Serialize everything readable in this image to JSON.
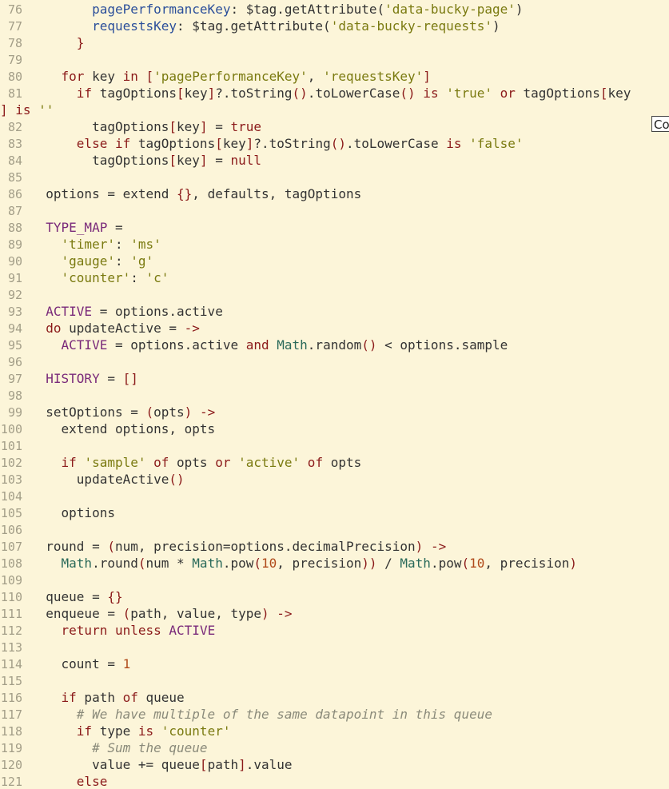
{
  "editor": {
    "lines": [
      {
        "num": "76",
        "indent": 4,
        "tokens": [
          {
            "t": "pagePerformanceKey",
            "c": "prop"
          },
          {
            "t": ": $tag.getAttribute(",
            "c": "default"
          },
          {
            "t": "'data-bucky-page'",
            "c": "str"
          },
          {
            "t": ")",
            "c": "default"
          }
        ]
      },
      {
        "num": "77",
        "indent": 4,
        "tokens": [
          {
            "t": "requestsKey",
            "c": "prop"
          },
          {
            "t": ": $tag.getAttribute(",
            "c": "default"
          },
          {
            "t": "'data-bucky-requests'",
            "c": "str"
          },
          {
            "t": ")",
            "c": "default"
          }
        ]
      },
      {
        "num": "78",
        "indent": 3,
        "tokens": [
          {
            "t": "}",
            "c": "punc"
          }
        ]
      },
      {
        "num": "79",
        "indent": 0,
        "tokens": []
      },
      {
        "num": "80",
        "indent": 2,
        "tokens": [
          {
            "t": "for",
            "c": "kw"
          },
          {
            "t": " key ",
            "c": "default"
          },
          {
            "t": "in",
            "c": "kw"
          },
          {
            "t": " [",
            "c": "punc"
          },
          {
            "t": "'pagePerformanceKey'",
            "c": "str"
          },
          {
            "t": ", ",
            "c": "default"
          },
          {
            "t": "'requestsKey'",
            "c": "str"
          },
          {
            "t": "]",
            "c": "punc"
          }
        ]
      },
      {
        "num": "81",
        "indent": 3,
        "tokens": [
          {
            "t": "if",
            "c": "kw"
          },
          {
            "t": " tagOptions",
            "c": "default"
          },
          {
            "t": "[",
            "c": "punc"
          },
          {
            "t": "key",
            "c": "default"
          },
          {
            "t": "]",
            "c": "punc"
          },
          {
            "t": "?.toString",
            "c": "default"
          },
          {
            "t": "()",
            "c": "punc"
          },
          {
            "t": ".toLowerCase",
            "c": "default"
          },
          {
            "t": "()",
            "c": "punc"
          },
          {
            "t": " is ",
            "c": "kw"
          },
          {
            "t": "'true'",
            "c": "str"
          },
          {
            "t": " or ",
            "c": "kw"
          },
          {
            "t": "tagOptions",
            "c": "default"
          },
          {
            "t": "[",
            "c": "punc"
          },
          {
            "t": "key",
            "c": "default"
          }
        ]
      },
      {
        "num": "",
        "indent": 0,
        "wrap": true,
        "tokens": [
          {
            "t": "]",
            "c": "punc"
          },
          {
            "t": " is ",
            "c": "kw"
          },
          {
            "t": "''",
            "c": "str"
          }
        ]
      },
      {
        "num": "82",
        "indent": 4,
        "tokens": [
          {
            "t": "tagOptions",
            "c": "default"
          },
          {
            "t": "[",
            "c": "punc"
          },
          {
            "t": "key",
            "c": "default"
          },
          {
            "t": "]",
            "c": "punc"
          },
          {
            "t": " = ",
            "c": "default"
          },
          {
            "t": "true",
            "c": "bool"
          }
        ]
      },
      {
        "num": "83",
        "indent": 3,
        "tokens": [
          {
            "t": "else if",
            "c": "kw"
          },
          {
            "t": " tagOptions",
            "c": "default"
          },
          {
            "t": "[",
            "c": "punc"
          },
          {
            "t": "key",
            "c": "default"
          },
          {
            "t": "]",
            "c": "punc"
          },
          {
            "t": "?.toString",
            "c": "default"
          },
          {
            "t": "()",
            "c": "punc"
          },
          {
            "t": ".toLowerCase",
            "c": "default"
          },
          {
            "t": " is ",
            "c": "kw"
          },
          {
            "t": "'false'",
            "c": "str"
          }
        ]
      },
      {
        "num": "84",
        "indent": 4,
        "tokens": [
          {
            "t": "tagOptions",
            "c": "default"
          },
          {
            "t": "[",
            "c": "punc"
          },
          {
            "t": "key",
            "c": "default"
          },
          {
            "t": "]",
            "c": "punc"
          },
          {
            "t": " = ",
            "c": "default"
          },
          {
            "t": "null",
            "c": "bool"
          }
        ]
      },
      {
        "num": "85",
        "indent": 0,
        "tokens": []
      },
      {
        "num": "86",
        "indent": 1,
        "tokens": [
          {
            "t": "options = extend ",
            "c": "default"
          },
          {
            "t": "{}",
            "c": "punc"
          },
          {
            "t": ", defaults, tagOptions",
            "c": "default"
          }
        ]
      },
      {
        "num": "87",
        "indent": 0,
        "tokens": []
      },
      {
        "num": "88",
        "indent": 1,
        "tokens": [
          {
            "t": "TYPE_MAP",
            "c": "const"
          },
          {
            "t": " =",
            "c": "default"
          }
        ]
      },
      {
        "num": "89",
        "indent": 2,
        "tokens": [
          {
            "t": "'timer'",
            "c": "str"
          },
          {
            "t": ": ",
            "c": "default"
          },
          {
            "t": "'ms'",
            "c": "str"
          }
        ]
      },
      {
        "num": "90",
        "indent": 2,
        "tokens": [
          {
            "t": "'gauge'",
            "c": "str"
          },
          {
            "t": ": ",
            "c": "default"
          },
          {
            "t": "'g'",
            "c": "str"
          }
        ]
      },
      {
        "num": "91",
        "indent": 2,
        "tokens": [
          {
            "t": "'counter'",
            "c": "str"
          },
          {
            "t": ": ",
            "c": "default"
          },
          {
            "t": "'c'",
            "c": "str"
          }
        ]
      },
      {
        "num": "92",
        "indent": 0,
        "tokens": []
      },
      {
        "num": "93",
        "indent": 1,
        "tokens": [
          {
            "t": "ACTIVE",
            "c": "const"
          },
          {
            "t": " = options.active",
            "c": "default"
          }
        ]
      },
      {
        "num": "94",
        "indent": 1,
        "tokens": [
          {
            "t": "do",
            "c": "kw"
          },
          {
            "t": " updateActive = ",
            "c": "default"
          },
          {
            "t": "->",
            "c": "kw"
          }
        ]
      },
      {
        "num": "95",
        "indent": 2,
        "tokens": [
          {
            "t": "ACTIVE",
            "c": "const"
          },
          {
            "t": " = options.active ",
            "c": "default"
          },
          {
            "t": "and",
            "c": "kw"
          },
          {
            "t": " ",
            "c": "default"
          },
          {
            "t": "Math",
            "c": "cls"
          },
          {
            "t": ".random",
            "c": "default"
          },
          {
            "t": "()",
            "c": "punc"
          },
          {
            "t": " < options.sample",
            "c": "default"
          }
        ]
      },
      {
        "num": "96",
        "indent": 0,
        "tokens": []
      },
      {
        "num": "97",
        "indent": 1,
        "tokens": [
          {
            "t": "HISTORY",
            "c": "const"
          },
          {
            "t": " = ",
            "c": "default"
          },
          {
            "t": "[]",
            "c": "punc"
          }
        ]
      },
      {
        "num": "98",
        "indent": 0,
        "tokens": []
      },
      {
        "num": "99",
        "indent": 1,
        "tokens": [
          {
            "t": "setOptions = ",
            "c": "default"
          },
          {
            "t": "(",
            "c": "punc"
          },
          {
            "t": "opts",
            "c": "default"
          },
          {
            "t": ")",
            "c": "punc"
          },
          {
            "t": " ",
            "c": "default"
          },
          {
            "t": "->",
            "c": "kw"
          }
        ]
      },
      {
        "num": "100",
        "indent": 2,
        "tokens": [
          {
            "t": "extend options, opts",
            "c": "default"
          }
        ]
      },
      {
        "num": "101",
        "indent": 0,
        "tokens": []
      },
      {
        "num": "102",
        "indent": 2,
        "tokens": [
          {
            "t": "if",
            "c": "kw"
          },
          {
            "t": " ",
            "c": "default"
          },
          {
            "t": "'sample'",
            "c": "str"
          },
          {
            "t": " of ",
            "c": "kw"
          },
          {
            "t": "opts ",
            "c": "default"
          },
          {
            "t": "or",
            "c": "kw"
          },
          {
            "t": " ",
            "c": "default"
          },
          {
            "t": "'active'",
            "c": "str"
          },
          {
            "t": " of ",
            "c": "kw"
          },
          {
            "t": "opts",
            "c": "default"
          }
        ]
      },
      {
        "num": "103",
        "indent": 3,
        "tokens": [
          {
            "t": "updateActive",
            "c": "default"
          },
          {
            "t": "()",
            "c": "punc"
          }
        ]
      },
      {
        "num": "104",
        "indent": 0,
        "tokens": []
      },
      {
        "num": "105",
        "indent": 2,
        "tokens": [
          {
            "t": "options",
            "c": "default"
          }
        ]
      },
      {
        "num": "106",
        "indent": 0,
        "tokens": []
      },
      {
        "num": "107",
        "indent": 1,
        "tokens": [
          {
            "t": "round = ",
            "c": "default"
          },
          {
            "t": "(",
            "c": "punc"
          },
          {
            "t": "num, precision=options.decimalPrecision",
            "c": "default"
          },
          {
            "t": ")",
            "c": "punc"
          },
          {
            "t": " ",
            "c": "default"
          },
          {
            "t": "->",
            "c": "kw"
          }
        ]
      },
      {
        "num": "108",
        "indent": 2,
        "tokens": [
          {
            "t": "Math",
            "c": "cls"
          },
          {
            "t": ".round",
            "c": "default"
          },
          {
            "t": "(",
            "c": "punc"
          },
          {
            "t": "num * ",
            "c": "default"
          },
          {
            "t": "Math",
            "c": "cls"
          },
          {
            "t": ".pow",
            "c": "default"
          },
          {
            "t": "(",
            "c": "punc"
          },
          {
            "t": "10",
            "c": "num"
          },
          {
            "t": ", precision",
            "c": "default"
          },
          {
            "t": "))",
            "c": "punc"
          },
          {
            "t": " / ",
            "c": "default"
          },
          {
            "t": "Math",
            "c": "cls"
          },
          {
            "t": ".pow",
            "c": "default"
          },
          {
            "t": "(",
            "c": "punc"
          },
          {
            "t": "10",
            "c": "num"
          },
          {
            "t": ", precision",
            "c": "default"
          },
          {
            "t": ")",
            "c": "punc"
          }
        ]
      },
      {
        "num": "109",
        "indent": 0,
        "tokens": []
      },
      {
        "num": "110",
        "indent": 1,
        "tokens": [
          {
            "t": "queue = ",
            "c": "default"
          },
          {
            "t": "{}",
            "c": "punc"
          }
        ]
      },
      {
        "num": "111",
        "indent": 1,
        "tokens": [
          {
            "t": "enqueue = ",
            "c": "default"
          },
          {
            "t": "(",
            "c": "punc"
          },
          {
            "t": "path, value, type",
            "c": "default"
          },
          {
            "t": ")",
            "c": "punc"
          },
          {
            "t": " ",
            "c": "default"
          },
          {
            "t": "->",
            "c": "kw"
          }
        ]
      },
      {
        "num": "112",
        "indent": 2,
        "tokens": [
          {
            "t": "return unless",
            "c": "kw"
          },
          {
            "t": " ",
            "c": "default"
          },
          {
            "t": "ACTIVE",
            "c": "const"
          }
        ]
      },
      {
        "num": "113",
        "indent": 0,
        "tokens": []
      },
      {
        "num": "114",
        "indent": 2,
        "tokens": [
          {
            "t": "count = ",
            "c": "default"
          },
          {
            "t": "1",
            "c": "num"
          }
        ]
      },
      {
        "num": "115",
        "indent": 0,
        "tokens": []
      },
      {
        "num": "116",
        "indent": 2,
        "tokens": [
          {
            "t": "if",
            "c": "kw"
          },
          {
            "t": " path ",
            "c": "default"
          },
          {
            "t": "of",
            "c": "kw"
          },
          {
            "t": " queue",
            "c": "default"
          }
        ]
      },
      {
        "num": "117",
        "indent": 3,
        "tokens": [
          {
            "t": "# We have multiple of the same datapoint in this queue",
            "c": "comment"
          }
        ]
      },
      {
        "num": "118",
        "indent": 3,
        "tokens": [
          {
            "t": "if",
            "c": "kw"
          },
          {
            "t": " type ",
            "c": "default"
          },
          {
            "t": "is",
            "c": "kw"
          },
          {
            "t": " ",
            "c": "default"
          },
          {
            "t": "'counter'",
            "c": "str"
          }
        ]
      },
      {
        "num": "119",
        "indent": 4,
        "tokens": [
          {
            "t": "# Sum the queue",
            "c": "comment"
          }
        ]
      },
      {
        "num": "120",
        "indent": 4,
        "tokens": [
          {
            "t": "value += queue",
            "c": "default"
          },
          {
            "t": "[",
            "c": "punc"
          },
          {
            "t": "path",
            "c": "default"
          },
          {
            "t": "]",
            "c": "punc"
          },
          {
            "t": ".value",
            "c": "default"
          }
        ]
      },
      {
        "num": "121",
        "indent": 3,
        "tokens": [
          {
            "t": "else",
            "c": "kw"
          }
        ]
      }
    ]
  },
  "tooltip": {
    "text": "Co"
  }
}
